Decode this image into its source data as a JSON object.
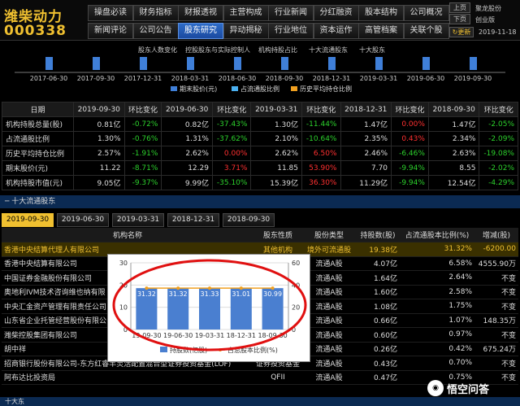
{
  "stock": {
    "name": "潍柴动力",
    "code": "000338"
  },
  "nav_row1": [
    "操盘必读",
    "财务指标",
    "财报透视",
    "主营构成",
    "行业新闻",
    "分红融资",
    "股本结构",
    "公司概况"
  ],
  "nav_row2": [
    "新闻评论",
    "公司公告",
    "股东研究",
    "异动揭秘",
    "行业地位",
    "资本运作",
    "高管档案",
    "关联个股"
  ],
  "active_nav": "股东研究",
  "right_panel": {
    "up": "上页",
    "down": "下页",
    "company": "聚龙股份",
    "industry": "创业版",
    "update": "更新",
    "date": "2019-11-18"
  },
  "subnav": [
    "股东人数变化",
    "控股股东与实际控制人",
    "机构持股占比",
    "十大流通股东",
    "十大股东"
  ],
  "top_chart": {
    "periods": [
      "2017-06-30",
      "2017-09-30",
      "2017-12-31",
      "2018-03-31",
      "2018-06-30",
      "2018-09-30",
      "2018-12-31",
      "2019-03-31",
      "2019-06-30",
      "2019-09-30"
    ],
    "legend": [
      "期末股价(元)",
      "占流通股比例",
      "历史平均持仓比例"
    ]
  },
  "metric_table": {
    "headers": [
      "日期",
      "2019-09-30",
      "环比变化",
      "2019-06-30",
      "环比变化",
      "2019-03-31",
      "环比变化",
      "2018-12-31",
      "环比变化",
      "2018-09-30",
      "环比变化"
    ],
    "rows": [
      [
        "机构持股总量(股)",
        "0.81亿",
        "-0.72%",
        "0.82亿",
        "-37.43%",
        "1.30亿",
        "-11.44%",
        "1.47亿",
        "0.00%",
        "1.47亿",
        "-2.05%"
      ],
      [
        "占流通股比例",
        "1.30%",
        "-0.76%",
        "1.31%",
        "-37.62%",
        "2.10%",
        "-10.64%",
        "2.35%",
        "0.43%",
        "2.34%",
        "-2.09%"
      ],
      [
        "历史平均持仓比例",
        "2.57%",
        "-1.91%",
        "2.62%",
        "0.00%",
        "2.62%",
        "6.50%",
        "2.46%",
        "-6.46%",
        "2.63%",
        "-19.08%"
      ],
      [
        "期末股价(元)",
        "11.22",
        "-8.71%",
        "12.29",
        "3.71%",
        "11.85",
        "53.90%",
        "7.70",
        "-9.94%",
        "8.55",
        "-2.02%"
      ],
      [
        "机构持股市值(元)",
        "9.05亿",
        "-9.37%",
        "9.99亿",
        "-35.10%",
        "15.39亿",
        "36.30%",
        "11.29亿",
        "-9.94%",
        "12.54亿",
        "-4.29%"
      ]
    ],
    "colors": [
      [
        "",
        "",
        "green",
        "",
        "green",
        "",
        "green",
        "",
        "red",
        "",
        "green"
      ],
      [
        "",
        "",
        "green",
        "",
        "green",
        "",
        "green",
        "",
        "red",
        "",
        "green"
      ],
      [
        "",
        "",
        "green",
        "",
        "red",
        "",
        "red",
        "",
        "green",
        "",
        "green"
      ],
      [
        "",
        "",
        "green",
        "",
        "red",
        "",
        "red",
        "",
        "green",
        "",
        "green"
      ],
      [
        "",
        "",
        "green",
        "",
        "green",
        "",
        "red",
        "",
        "green",
        "",
        "green"
      ]
    ]
  },
  "holders_section": {
    "title": "十大流通股东",
    "tabs": [
      "2019-09-30",
      "2019-06-30",
      "2019-03-31",
      "2018-12-31",
      "2018-09-30"
    ],
    "headers": [
      "机构名称",
      "股东性质",
      "股份类型",
      "持股数(股)",
      "占流通股本比例(%)",
      "增减(股)"
    ],
    "rows": [
      [
        "香港中央结算代理人有限公司",
        "其他机构",
        "境外可流通股",
        "19.38亿",
        "31.32%",
        "-6200.00"
      ],
      [
        "香港中央结算有限公司",
        "",
        "流通A股",
        "4.07亿",
        "6.58%",
        "4555.90万"
      ],
      [
        "中国证券金融股份有限公司",
        "",
        "流通A股",
        "1.64亿",
        "2.64%",
        "不变"
      ],
      [
        "奥地利IVM技术咨询维也纳有限",
        "",
        "流通A股",
        "1.60亿",
        "2.58%",
        "不变"
      ],
      [
        "中央汇金资产管理有限责任公司",
        "",
        "流通A股",
        "1.08亿",
        "1.75%",
        "不变"
      ],
      [
        "山东省企业托管经营股份有限公",
        "",
        "流通A股",
        "0.66亿",
        "1.07%",
        "148.35万"
      ],
      [
        "潍柴控股集团有限公司",
        "",
        "流通A股",
        "0.60亿",
        "0.97%",
        "不变"
      ],
      [
        "胡中祥",
        "",
        "流通A股",
        "0.26亿",
        "0.42%",
        "675.24万"
      ],
      [
        "招商银行股份有限公司-东方红睿丰灵活配置混合型证券投资基金(LOF)",
        "证券投资基金",
        "流通A股",
        "0.43亿",
        "0.70%",
        "不变"
      ],
      [
        "阿布达比投资局",
        "QFII",
        "流通A股",
        "0.47亿",
        "0.75%",
        "不变"
      ]
    ]
  },
  "popup_chart": {
    "categories": [
      "2019-09-30",
      "2019-06-30",
      "2019-03-31",
      "2018-12-31",
      "2018-09-30"
    ],
    "tick_labels": [
      "19-09-30",
      "19-06-30",
      "19-03-31",
      "18-12-31",
      "18-09-30"
    ],
    "bar_values": [
      31.32,
      31.32,
      31.33,
      31.01,
      30.99
    ],
    "bar_labels": [
      "31.32",
      "31.32",
      "31.33",
      "31.01",
      "30.99"
    ],
    "left_axis": [
      "30",
      "20",
      "10",
      "0"
    ],
    "right_axis": [
      "60",
      "40",
      "20",
      "0"
    ],
    "legend": [
      "持股数(亿股)",
      "占总股本比例(%)"
    ]
  },
  "chart_data": {
    "type": "bar",
    "categories": [
      "19-09-30",
      "19-06-30",
      "19-03-31",
      "18-12-31",
      "18-09-30"
    ],
    "series": [
      {
        "name": "持股数(亿股)",
        "values": [
          31.32,
          31.32,
          31.33,
          31.01,
          30.99
        ]
      }
    ],
    "ylim": [
      0,
      30
    ],
    "y2lim": [
      0,
      60
    ]
  },
  "bottom": {
    "title": "十大东"
  },
  "watermark": {
    "text": "悟空问答"
  },
  "colors": {
    "accent": "#f0c030",
    "nav_active": "#2e6cc8",
    "up": "#ff3030",
    "down": "#2cd02c",
    "section": "#0b2a52"
  }
}
